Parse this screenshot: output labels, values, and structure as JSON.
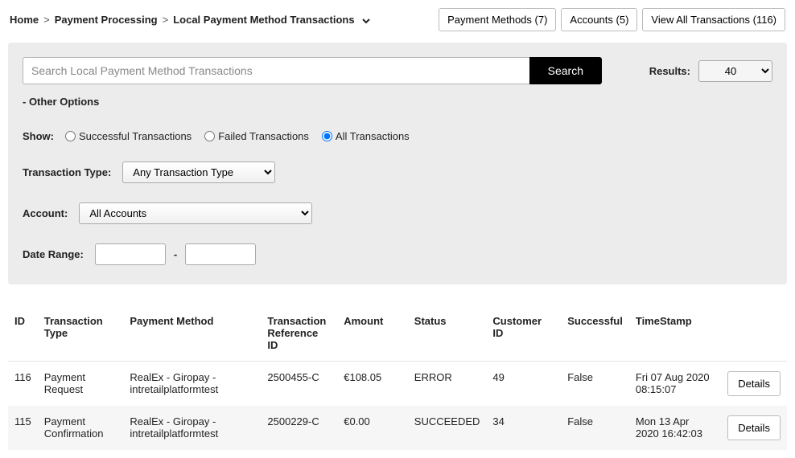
{
  "breadcrumb": {
    "home": "Home",
    "section": "Payment Processing",
    "page": "Local Payment Method Transactions"
  },
  "topbar": {
    "payment_methods": "Payment Methods (7)",
    "accounts": "Accounts (5)",
    "view_all": "View All Transactions (116)"
  },
  "search": {
    "placeholder": "Search Local Payment Method Transactions",
    "button": "Search"
  },
  "results": {
    "label": "Results:",
    "value": "40"
  },
  "other_options_label": "- Other Options",
  "show": {
    "label": "Show:",
    "opt_success": "Successful Transactions",
    "opt_failed": "Failed Transactions",
    "opt_all": "All Transactions"
  },
  "transaction_type": {
    "label": "Transaction Type:",
    "value": "Any Transaction Type"
  },
  "account": {
    "label": "Account:",
    "value": "All Accounts"
  },
  "date_range": {
    "label": "Date Range:",
    "sep": "-"
  },
  "table": {
    "headers": {
      "id": "ID",
      "type": "Transaction Type",
      "method": "Payment Method",
      "ref": "Transaction Reference ID",
      "amount": "Amount",
      "status": "Status",
      "customer": "Customer ID",
      "successful": "Successful",
      "timestamp": "TimeStamp",
      "action": ""
    },
    "rows": [
      {
        "id": "116",
        "type": "Payment Request",
        "method": "RealEx - Giropay - intretailplatformtest",
        "ref": "2500455-C",
        "amount": "€108.05",
        "status": "ERROR",
        "customer": "49",
        "successful": "False",
        "timestamp": "Fri 07 Aug 2020 08:15:07",
        "action": "Details"
      },
      {
        "id": "115",
        "type": "Payment Confirmation",
        "method": "RealEx - Giropay - intretailplatformtest",
        "ref": "2500229-C",
        "amount": "€0.00",
        "status": "SUCCEEDED",
        "customer": "34",
        "successful": "False",
        "timestamp": "Mon 13 Apr 2020 16:42:03",
        "action": "Details"
      }
    ]
  }
}
